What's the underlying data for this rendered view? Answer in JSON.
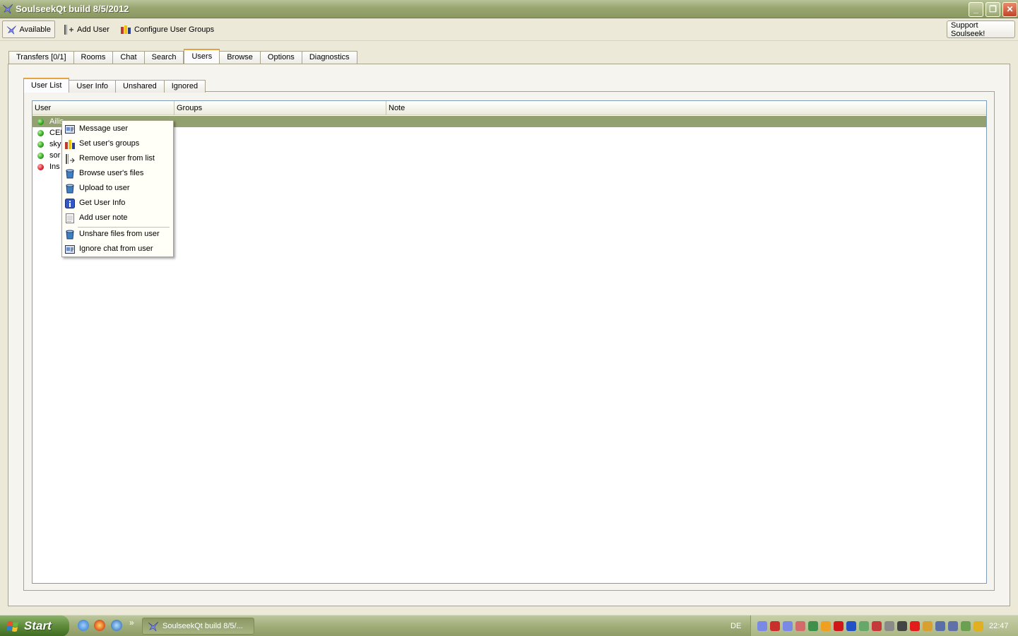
{
  "window": {
    "title": "SoulseekQt build 8/5/2012",
    "minimize_label": "_",
    "restore_label": "❐",
    "close_label": "✕"
  },
  "toolbar": {
    "status_label": "Available",
    "add_user_label": "Add User",
    "configure_groups_label": "Configure User Groups",
    "support_label": "Support Soulseek!"
  },
  "main_tabs": [
    "Transfers [0/1]",
    "Rooms",
    "Chat",
    "Search",
    "Users",
    "Browse",
    "Options",
    "Diagnostics"
  ],
  "main_tabs_active": "Users",
  "sub_tabs": [
    "User List",
    "User Info",
    "Unshared",
    "Ignored"
  ],
  "sub_tabs_active": "User List",
  "table": {
    "columns": [
      "User",
      "Groups",
      "Note"
    ],
    "rows": [
      {
        "user": "Ailis",
        "status": "online",
        "selected": true
      },
      {
        "user": "CEL",
        "status": "online",
        "selected": false
      },
      {
        "user": "sky",
        "status": "online",
        "selected": false
      },
      {
        "user": "sor",
        "status": "online",
        "selected": false
      },
      {
        "user": "Ins",
        "status": "offline",
        "selected": false
      }
    ]
  },
  "context_menu": {
    "items": [
      {
        "label": "Message user",
        "icon": "message-icon"
      },
      {
        "label": "Set user's groups",
        "icon": "groups-icon"
      },
      {
        "label": "Remove user from list",
        "icon": "remove-user-icon"
      },
      {
        "label": "Browse user's files",
        "icon": "browse-files-icon"
      },
      {
        "label": "Upload to user",
        "icon": "upload-icon"
      },
      {
        "label": "Get User Info",
        "icon": "info-icon"
      },
      {
        "label": "Add user note",
        "icon": "note-icon"
      },
      {
        "label": "Unshare files from user",
        "icon": "unshare-icon"
      },
      {
        "label": "Ignore chat from user",
        "icon": "ignore-chat-icon"
      }
    ]
  },
  "taskbar": {
    "start_label": "Start",
    "task_label": "SoulseekQt build 8/5/...",
    "language": "DE",
    "clock": "22:47",
    "quicklaunch_more": "»"
  },
  "colors": {
    "selection": "#93a070",
    "online": "#2da51a",
    "offline": "#e0202a"
  }
}
